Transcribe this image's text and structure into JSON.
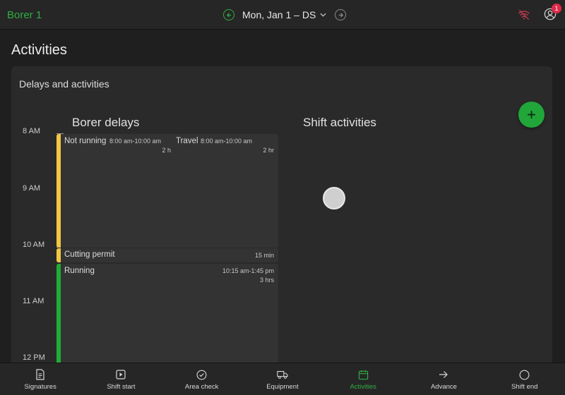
{
  "header": {
    "app_title": "Borer 1",
    "date_label": "Mon, Jan 1 – DS",
    "notification_count": "1"
  },
  "page": {
    "title": "Activities"
  },
  "card": {
    "title": "Delays and activities",
    "left_column_title": "Borer delays",
    "right_column_title": "Shift activities"
  },
  "timeline": {
    "hours": [
      "8 AM",
      "9 AM",
      "10 AM",
      "11 AM",
      "12 PM"
    ]
  },
  "events": {
    "not_running": {
      "name": "Not running",
      "time": "8:00 am-10:00 am",
      "duration": "2 hr",
      "color": "#f2c744"
    },
    "travel": {
      "name": "Travel",
      "time": "8:00 am-10:00 am",
      "duration": "2 hr",
      "color": "#e8c23a"
    },
    "cutting_permit": {
      "name": "Cutting permit",
      "duration": "15 min",
      "color": "#f2c744"
    },
    "running": {
      "name": "Running",
      "time": "10:15 am-1:45 pm",
      "duration": "3 hrs",
      "color": "#1fae35"
    }
  },
  "nav": [
    {
      "label": "Signatures",
      "icon": "document-icon"
    },
    {
      "label": "Shift start",
      "icon": "play-icon"
    },
    {
      "label": "Area check",
      "icon": "check-circle-icon"
    },
    {
      "label": "Equipment",
      "icon": "truck-icon"
    },
    {
      "label": "Activities",
      "icon": "calendar-icon",
      "active": true
    },
    {
      "label": "Advance",
      "icon": "arrow-right-icon"
    },
    {
      "label": "Shift end",
      "icon": "circle-icon"
    }
  ],
  "colors": {
    "accent": "#2fae43",
    "warning": "#f2c744",
    "badge": "#e0294a"
  }
}
